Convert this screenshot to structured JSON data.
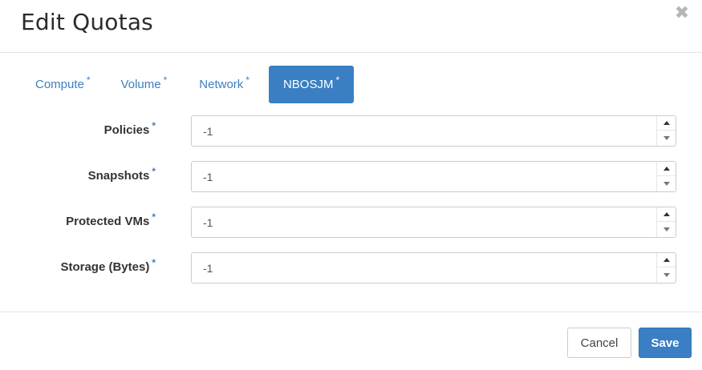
{
  "dialog": {
    "title": "Edit Quotas",
    "close_glyph": "✖"
  },
  "tabs": [
    {
      "label": "Compute",
      "required": "*",
      "active": false
    },
    {
      "label": "Volume",
      "required": "*",
      "active": false
    },
    {
      "label": "Network",
      "required": "*",
      "active": false
    },
    {
      "label": "NBOSJM",
      "required": "*",
      "active": true
    }
  ],
  "fields": [
    {
      "label": "Policies",
      "required": "*",
      "value": "-1"
    },
    {
      "label": "Snapshots",
      "required": "*",
      "value": "-1"
    },
    {
      "label": "Protected VMs",
      "required": "*",
      "value": "-1"
    },
    {
      "label": "Storage (Bytes)",
      "required": "*",
      "value": "-1"
    }
  ],
  "footer": {
    "cancel_label": "Cancel",
    "save_label": "Save"
  },
  "colors": {
    "accent": "#3a7fc3",
    "link": "#3c7fc0",
    "border": "#cccccc"
  }
}
